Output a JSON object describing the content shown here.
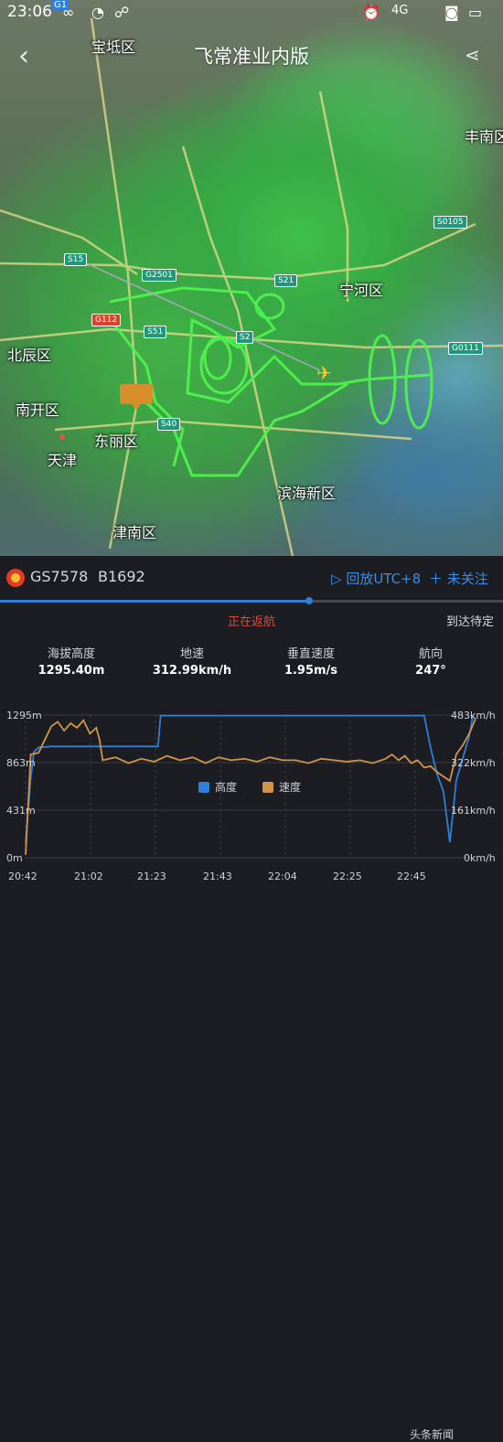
{
  "status_bar": {
    "time": "23:06",
    "signal": "4G",
    "net_badge": "G1"
  },
  "header": {
    "title": "飞常准业内版"
  },
  "map": {
    "places": [
      "宝坻区",
      "丰南区",
      "宁河区",
      "北辰区",
      "南开区",
      "东丽区",
      "天津",
      "滨海新区",
      "津南区"
    ],
    "roads": [
      "S15",
      "G2501",
      "S21",
      "G112",
      "S51",
      "S2",
      "S40",
      "S0105",
      "G0111"
    ]
  },
  "flight": {
    "flight_no": "GS7578",
    "registration": "B1692",
    "replay_label": "回放UTC+8",
    "follow_label": "未关注",
    "status": "正在返航",
    "arrival_status": "到达待定",
    "progress": 0.615
  },
  "stats": [
    {
      "label": "海拔高度",
      "value": "1295.40m"
    },
    {
      "label": "地速",
      "value": "312.99km/h"
    },
    {
      "label": "垂直速度",
      "value": "1.95m/s"
    },
    {
      "label": "航向",
      "value": "247°"
    }
  ],
  "chart_data": {
    "type": "line",
    "x": [
      "20:42",
      "21:02",
      "21:23",
      "21:43",
      "22:04",
      "22:25",
      "22:45"
    ],
    "y_left_ticks": [
      "1295m",
      "863m",
      "431m",
      "0m"
    ],
    "y_right_ticks": [
      "483km/h",
      "322km/h",
      "161km/h",
      "0km/h"
    ],
    "ylim_left": [
      0,
      1295
    ],
    "ylim_right": [
      0,
      483
    ],
    "series": [
      {
        "name": "高度",
        "color": "#2f7fd6",
        "axis": "left",
        "points": [
          [
            0,
            130
          ],
          [
            0.8,
            720
          ],
          [
            1.3,
            960
          ],
          [
            2,
            1000
          ],
          [
            4,
            1010
          ],
          [
            6,
            1010
          ],
          [
            8,
            1010
          ],
          [
            10,
            1010
          ],
          [
            12,
            1010
          ],
          [
            14,
            1010
          ],
          [
            16,
            1010
          ],
          [
            18,
            1010
          ],
          [
            20,
            1010
          ],
          [
            20.6,
            1010
          ],
          [
            21,
            1290
          ],
          [
            24,
            1290
          ],
          [
            28,
            1290
          ],
          [
            32,
            1290
          ],
          [
            36,
            1290
          ],
          [
            40,
            1290
          ],
          [
            44,
            1290
          ],
          [
            48,
            1290
          ],
          [
            52,
            1290
          ],
          [
            56,
            1290
          ],
          [
            60,
            1290
          ],
          [
            62,
            1290
          ],
          [
            63,
            1000
          ],
          [
            64,
            760
          ],
          [
            65,
            600
          ],
          [
            66,
            140
          ],
          [
            67,
            700
          ],
          [
            68,
            900
          ],
          [
            69,
            1100
          ],
          [
            69.6,
            1290
          ]
        ]
      },
      {
        "name": "速度",
        "color": "#d19447",
        "axis": "right",
        "points": [
          [
            0,
            10
          ],
          [
            0.8,
            350
          ],
          [
            2,
            355
          ],
          [
            3,
            400
          ],
          [
            4,
            445
          ],
          [
            5,
            460
          ],
          [
            6,
            430
          ],
          [
            7,
            455
          ],
          [
            8,
            440
          ],
          [
            9,
            465
          ],
          [
            10,
            420
          ],
          [
            11,
            440
          ],
          [
            11.5,
            400
          ],
          [
            12,
            330
          ],
          [
            14,
            340
          ],
          [
            16,
            320
          ],
          [
            18,
            335
          ],
          [
            20,
            325
          ],
          [
            22,
            345
          ],
          [
            24,
            330
          ],
          [
            26,
            340
          ],
          [
            28,
            320
          ],
          [
            30,
            340
          ],
          [
            32,
            330
          ],
          [
            34,
            335
          ],
          [
            36,
            325
          ],
          [
            38,
            340
          ],
          [
            40,
            330
          ],
          [
            42,
            330
          ],
          [
            44,
            320
          ],
          [
            46,
            335
          ],
          [
            48,
            330
          ],
          [
            50,
            325
          ],
          [
            52,
            330
          ],
          [
            54,
            320
          ],
          [
            56,
            335
          ],
          [
            57,
            350
          ],
          [
            58,
            330
          ],
          [
            59,
            345
          ],
          [
            60,
            320
          ],
          [
            61,
            330
          ],
          [
            62,
            305
          ],
          [
            63,
            310
          ],
          [
            64,
            290
          ],
          [
            65,
            275
          ],
          [
            66,
            260
          ],
          [
            67,
            350
          ],
          [
            68,
            380
          ],
          [
            69,
            420
          ],
          [
            70,
            470
          ]
        ]
      }
    ]
  },
  "watermark": "头条新闻"
}
